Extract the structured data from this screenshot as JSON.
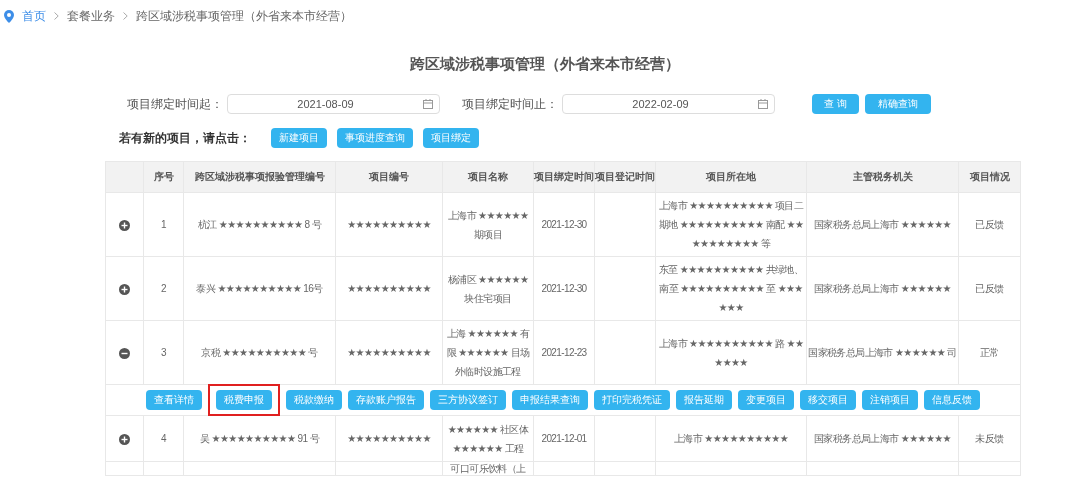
{
  "breadcrumb": [
    {
      "label": "首页",
      "link": true
    },
    {
      "label": "套餐业务",
      "link": false
    },
    {
      "label": "跨区域涉税事项管理（外省来本市经营）",
      "link": false
    }
  ],
  "title": "跨区域涉税事项管理（外省来本市经营）",
  "filters": [
    {
      "label": "项目绑定时间起：",
      "value": "2021-08-09"
    },
    {
      "label": "项目绑定时间止：",
      "value": "2022-02-09"
    }
  ],
  "query_buttons": [
    "查 询",
    "精确查询"
  ],
  "new_project": {
    "prompt": "若有新的项目，请点击：",
    "buttons": [
      "新建项目",
      "事项进度查询",
      "项目绑定"
    ]
  },
  "table": {
    "columns": [
      "序号",
      "跨区域涉税事项报验管理编号",
      "项目编号",
      "项目名称",
      "项目绑定时间",
      "项目登记时间",
      "项目所在地",
      "主管税务机关",
      "项目情况"
    ],
    "rows": [
      {
        "expanded": false,
        "cells": [
          "1",
          "杭江 ★★★★★★★★★★ 8 号",
          "★★★★★★★★★★",
          "上海市 ★★★★★★ 期项目",
          "2021-12-30",
          null,
          "上海市 ★★★★★★★★★★ 项目二期地 ★★★★★★★★★★ 南配 ★★★★★★★★★★ 等",
          "国家税务总局上海市 ★★★★★★",
          "已反馈"
        ]
      },
      {
        "expanded": false,
        "cells": [
          "2",
          "泰兴 ★★★★★★★★★★ 16号",
          "★★★★★★★★★★",
          "杨浦区 ★★★★★★ 块住宅项目",
          "2021-12-30",
          null,
          "东至 ★★★★★★★★★★ 共绿地、南至 ★★★★★★★★★★ 至 ★★★★★★",
          "国家税务总局上海市 ★★★★★★",
          "已反馈"
        ]
      },
      {
        "expanded": true,
        "cells": [
          "3",
          "京税 ★★★★★★★★★★ 号",
          "★★★★★★★★★★",
          "上海 ★★★★★★ 有限 ★★★★★★ 目场外临时设施工程",
          "2021-12-23",
          null,
          "上海市 ★★★★★★★★★★ 路 ★★★★★★",
          "国家税务总局上海市 ★★★★★★ 司",
          "正常"
        ],
        "actions": [
          {
            "label": "查看详情",
            "highlighted": false
          },
          {
            "label": "税费申报",
            "highlighted": true
          },
          {
            "label": "税款缴纳",
            "highlighted": false
          },
          {
            "label": "存款账户报告",
            "highlighted": false
          },
          {
            "label": "三方协议签订",
            "highlighted": false
          },
          {
            "label": "申报结果查询",
            "highlighted": false
          },
          {
            "label": "打印完税凭证",
            "highlighted": false
          },
          {
            "label": "报告延期",
            "highlighted": false
          },
          {
            "label": "变更项目",
            "highlighted": false
          },
          {
            "label": "移交项目",
            "highlighted": false
          },
          {
            "label": "注销项目",
            "highlighted": false
          },
          {
            "label": "信息反馈",
            "highlighted": false
          }
        ]
      },
      {
        "expanded": false,
        "cells": [
          "4",
          "吴 ★★★★★★★★★★ 91 号",
          "★★★★★★★★★★",
          "★★★★★★ 社区体 ★★★★★★ 工程",
          "2021-12-01",
          null,
          "上海市 ★★★★★★★★★★",
          "国家税务总局上海市 ★★★★★★",
          "未反馈"
        ]
      },
      {
        "cells": [
          null,
          null,
          null,
          "可口可乐饮料（上",
          null,
          null,
          null,
          null,
          null
        ]
      }
    ]
  }
}
